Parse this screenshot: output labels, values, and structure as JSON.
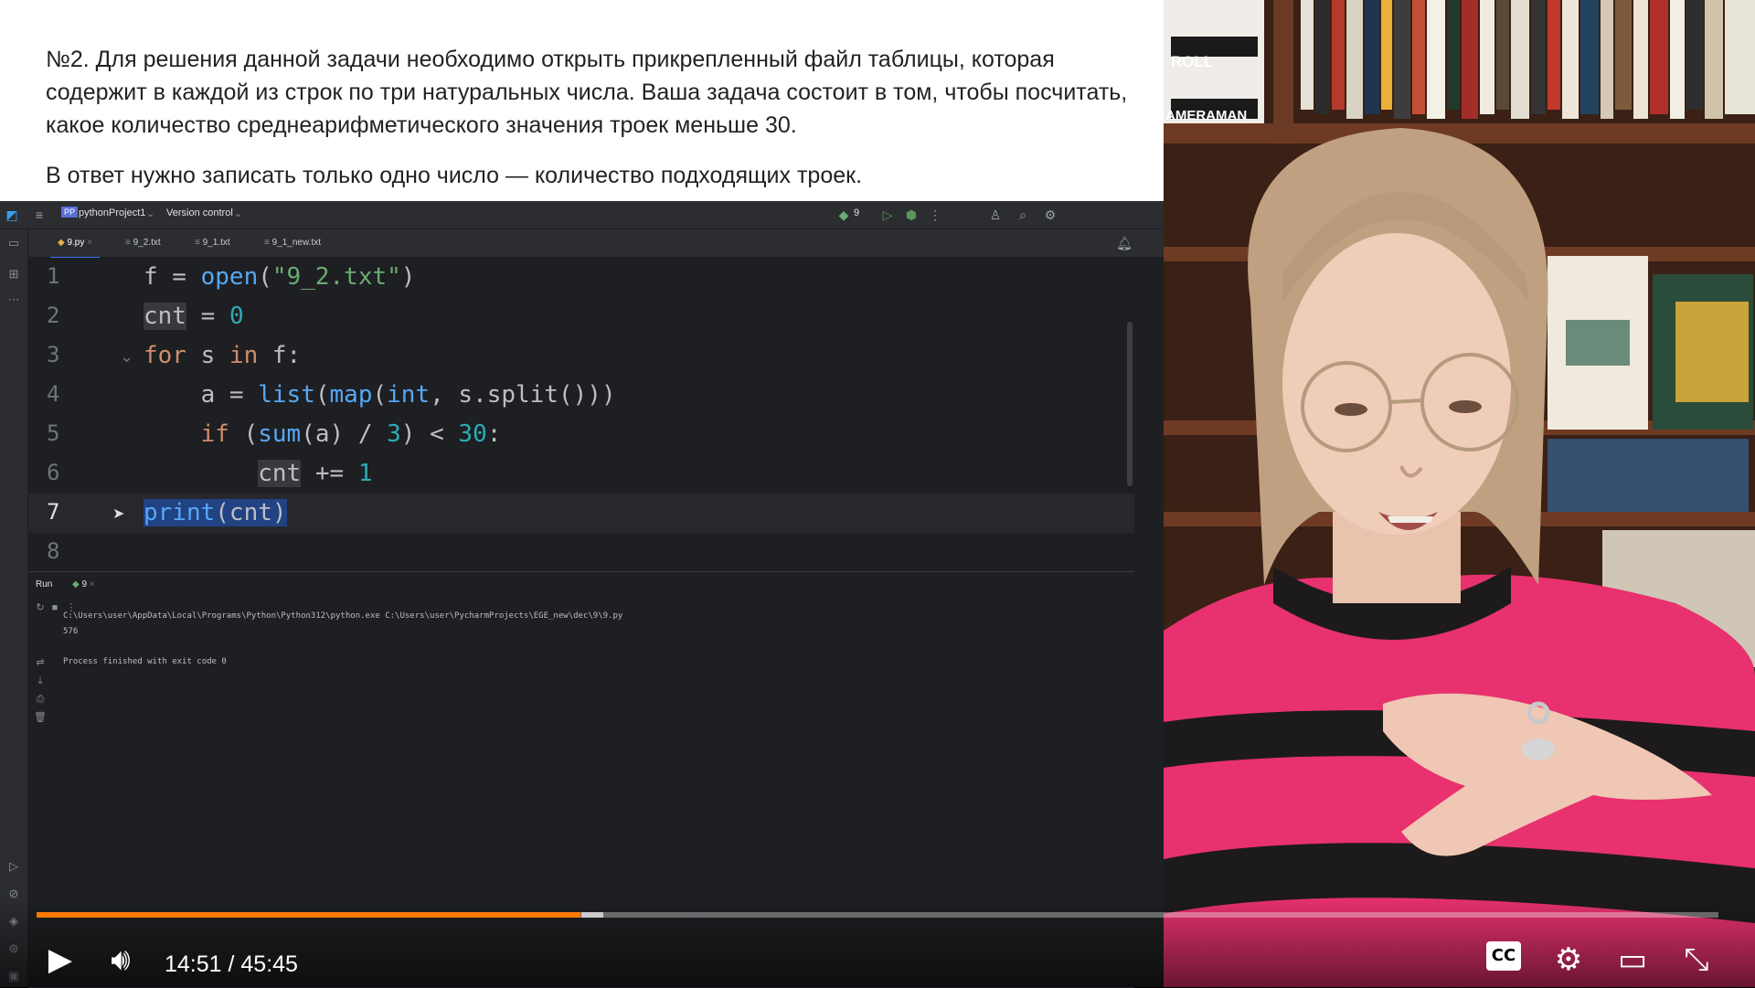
{
  "task": {
    "paragraph1": "№2. Для решения данной задачи необходимо открыть прикрепленный файл таблицы, которая содержит в каждой из строк по три натуральных числа. Ваша задача состоит в том, чтобы посчитать, какое количество среднеарифметического значения троек меньше 30.",
    "paragraph2": "В ответ нужно записать только одно число — количество подходящих троек."
  },
  "ide": {
    "project_badge": "PP",
    "project": "pythonProject1",
    "vcs": "Version control",
    "run_config": "9",
    "tabs": [
      {
        "label": "9.py",
        "active": true
      },
      {
        "label": "9_2.txt",
        "active": false
      },
      {
        "label": "9_1.txt",
        "active": false
      },
      {
        "label": "9_1_new.txt",
        "active": false
      }
    ],
    "line_numbers": [
      "1",
      "2",
      "3",
      "4",
      "5",
      "6",
      "7",
      "8"
    ],
    "run": {
      "tab": "Run",
      "config": "9",
      "command": "C:\\Users\\user\\AppData\\Local\\Programs\\Python\\Python312\\python.exe C:\\Users\\user\\PycharmProjects\\EGE_new\\dec\\9\\9.py",
      "output": "576",
      "finished": "Process finished with exit code 0"
    }
  },
  "player": {
    "time": "14:51 / 45:45",
    "progress": 0.3235,
    "icons": [
      "play-icon",
      "volume-icon",
      "captions-icon",
      "settings-icon",
      "miniplayer-icon",
      "fullscreen-exit-icon"
    ],
    "accent": "#ff7a00"
  },
  "background": {
    "shelf_label_1": "ROLL",
    "shelf_label_2": "AMERAMAN"
  }
}
